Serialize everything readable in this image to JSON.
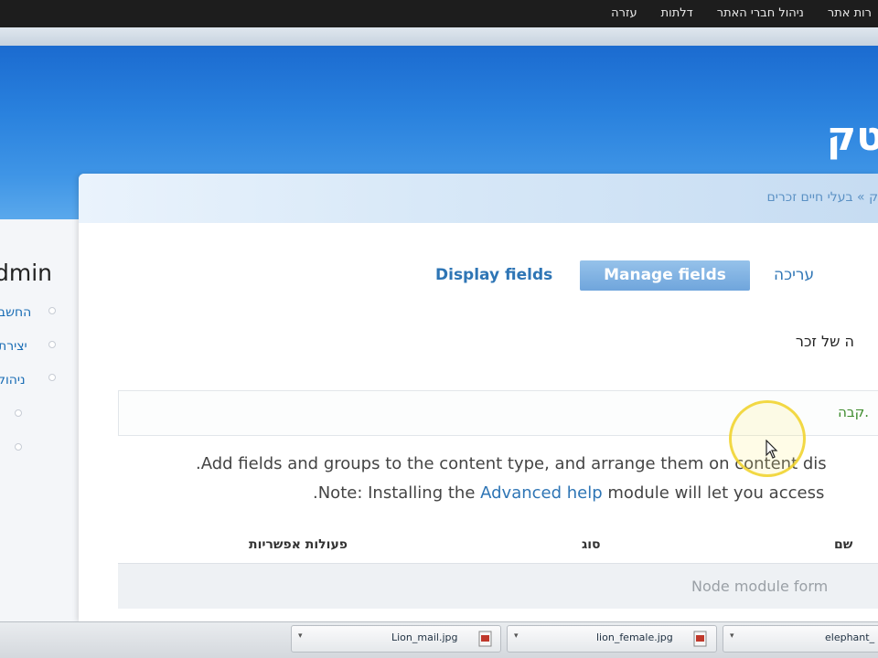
{
  "toolbar": {
    "items": [
      "רות אתר",
      "ניהול חברי האתר",
      "דלתות",
      "עזרה"
    ]
  },
  "header": {
    "site_title": "טק"
  },
  "breadcrumb": {
    "text": "ק » בעלי חיים זכרים"
  },
  "sidebar": {
    "user": "dmin",
    "items": [
      "החשב",
      "יצירת",
      "ניהול"
    ]
  },
  "tabs": {
    "display_fields": "Display fields",
    "manage_fields": "Manage fields",
    "edit": "עריכה"
  },
  "content": {
    "subtitle": "ה של זכר",
    "status_message": "קבה.",
    "help_line1": ".Add fields and groups to the content type, and arrange them on content dis",
    "help_line2_prefix": ".Note: Installing the ",
    "help_line2_link": "Advanced help",
    "help_line2_suffix": " module will let you access"
  },
  "table": {
    "headers": {
      "name": "שם",
      "type": "סוג",
      "operations": "פעולות אפשריות"
    },
    "rows": [
      {
        "name": "Node module form"
      }
    ]
  },
  "downloads": {
    "items": [
      "Lion_mail.jpg",
      "lion_female.jpg",
      "elephant_"
    ]
  },
  "colors": {
    "accent": "#2e75b5",
    "header_blue": "#2a82de",
    "status_green": "#3b8a2a"
  }
}
